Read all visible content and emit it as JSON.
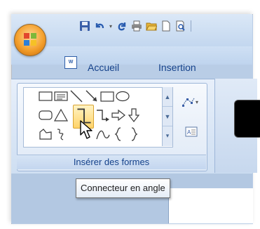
{
  "tabs": {
    "home": "Accueil",
    "insert": "Insertion"
  },
  "group": {
    "label": "Insérer des formes"
  },
  "tooltip": {
    "text": "Connecteur en angle"
  },
  "icons": [
    "office-button-icon",
    "save-icon",
    "undo-icon",
    "redo-icon",
    "print-icon",
    "open-folder-icon",
    "new-document-icon",
    "print-preview-icon",
    "document-icon",
    "edit-shape-icon",
    "text-box-icon",
    "mouse-pointer-icon"
  ],
  "colors": {
    "tab_text": "#15428b",
    "hover_fill": "#ffd46a"
  }
}
